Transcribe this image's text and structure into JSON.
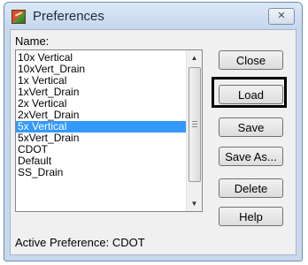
{
  "window": {
    "title": "Preferences",
    "close_glyph": "✕"
  },
  "list": {
    "label": "Name:",
    "items": [
      "10x Vertical",
      "10xVert_Drain",
      "1x Vertical",
      "1xVert_Drain",
      "2x Vertical",
      "2xVert_Drain",
      "5x Vertical",
      "5xVert_Drain",
      "CDOT",
      "Default",
      "SS_Drain"
    ],
    "selected": "5x Vertical",
    "scroll_up_glyph": "▲",
    "scroll_down_glyph": "▼"
  },
  "buttons": {
    "close": "Close",
    "load": "Load",
    "save": "Save",
    "save_as": "Save As...",
    "delete": "Delete",
    "help": "Help"
  },
  "status": "Active Preference: CDOT",
  "colors": {
    "selection": "#3399ff",
    "highlight_frame": "#000000"
  },
  "icons": {
    "app": "preferences-app-icon",
    "close": "close-icon"
  }
}
